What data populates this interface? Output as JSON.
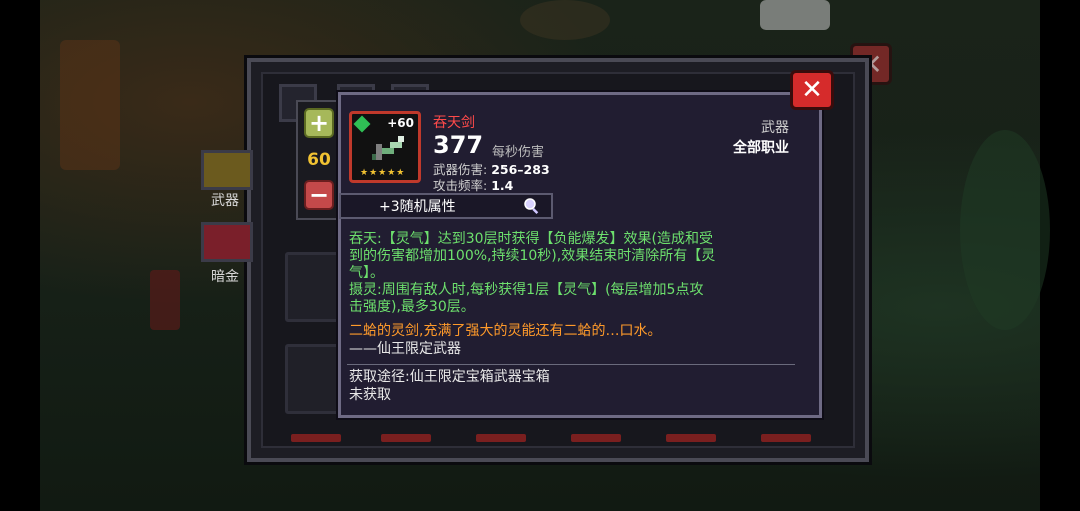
{
  "item": {
    "name": "吞天剑",
    "upgrade_level": "+60",
    "dps_value": "377",
    "dps_label": "每秒伤害",
    "damage_label": "武器伤害:",
    "damage_value": "256–283",
    "rate_label": "攻击频率:",
    "rate_value": "1.4",
    "stars": "★★★★★",
    "type": "武器",
    "class": "全部职业",
    "random_attr": "+3随机属性"
  },
  "description": {
    "line1": "吞天:【灵气】达到30层时获得【负能爆发】效果(造成和受",
    "line2": "到的伤害都增加100%,持续10秒),效果结束时清除所有【灵",
    "line3": "气】。",
    "line4": "摄灵:周围有敌人时,每秒获得1层【灵气】(每层增加5点攻",
    "line5": "击强度),最多30层。",
    "flavor": "二蛤的灵剑,充满了强大的灵能还有二蛤的…口水。",
    "signature": "——仙王限定武器",
    "source": "获取途径:仙王限定宝箱武器宝箱",
    "status": "未获取"
  },
  "stepper": {
    "plus": "+",
    "level": "60",
    "minus": "−"
  },
  "categories": {
    "weapon": "武器",
    "dark_gold": "暗金"
  },
  "colors": {
    "name_red": "#ff4a4a",
    "effect_green": "#6de06d",
    "flavor_orange": "#ff9a2a",
    "star_gold": "#f1c232"
  },
  "icons": {
    "close": "close-icon",
    "magnify": "magnifier-icon",
    "gem": "gem-icon"
  }
}
